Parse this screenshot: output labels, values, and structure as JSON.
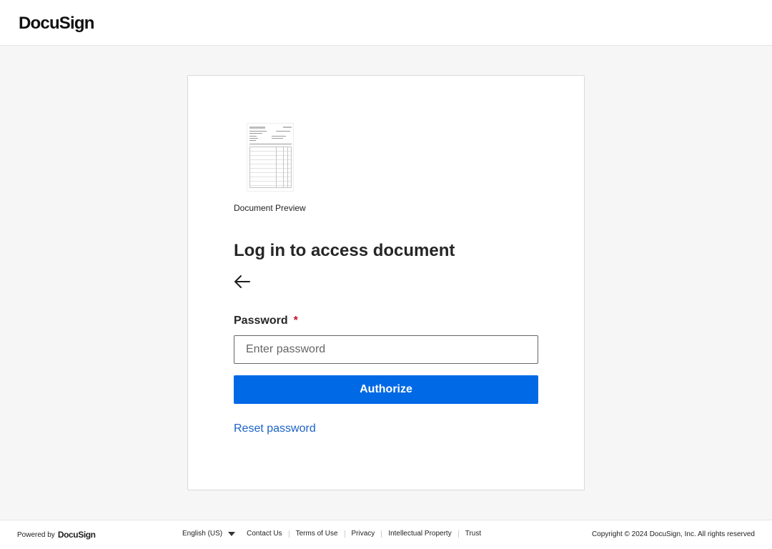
{
  "header": {
    "brand": "DocuSign"
  },
  "card": {
    "preview_label": "Document Preview",
    "heading": "Log in to access document",
    "password_label": "Password",
    "required_mark": "*",
    "password_placeholder": "Enter password",
    "password_value": "",
    "authorize_label": "Authorize",
    "reset_label": "Reset password"
  },
  "footer": {
    "powered_by": "Powered by",
    "powered_brand": "DocuSign",
    "language": "English (US)",
    "links": [
      "Contact Us",
      "Terms of Use",
      "Privacy",
      "Intellectual Property",
      "Trust"
    ],
    "copyright": "Copyright © 2024 DocuSign, Inc. All rights reserved"
  },
  "colors": {
    "primary": "#0069e5",
    "link": "#1b63c6",
    "required": "#c8102e",
    "background": "#f6f6f6"
  },
  "icons": {
    "back": "arrow-left-icon",
    "language_toggle": "caret-down-icon"
  }
}
